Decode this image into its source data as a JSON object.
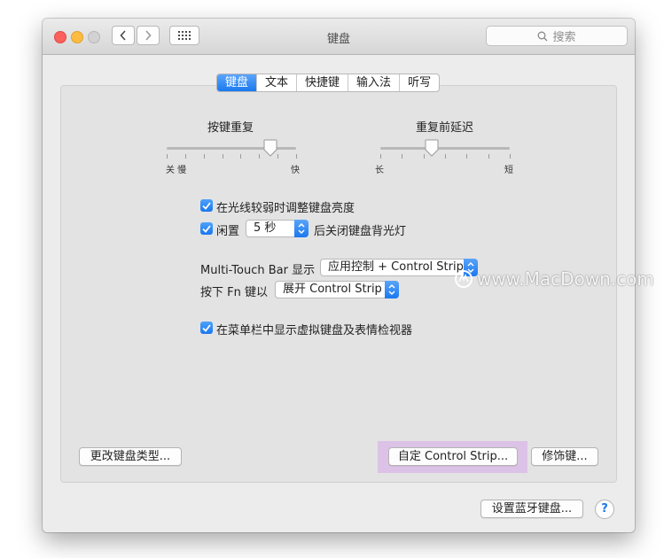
{
  "window": {
    "title": "键盘",
    "search_placeholder": "搜索"
  },
  "tabs": [
    {
      "label": "键盘",
      "active": true
    },
    {
      "label": "文本",
      "active": false
    },
    {
      "label": "快捷键",
      "active": false
    },
    {
      "label": "输入法",
      "active": false
    },
    {
      "label": "听写",
      "active": false
    }
  ],
  "key_repeat": {
    "title": "按键重复",
    "left_label": "关 慢",
    "right_label": "快",
    "value_fraction": 0.8
  },
  "delay_until_repeat": {
    "title": "重复前延迟",
    "left_label": "长",
    "right_label": "短",
    "value_fraction": 0.4
  },
  "options": {
    "adjust_brightness": {
      "label": "在光线较弱时调整键盘亮度",
      "checked": true
    },
    "idle": {
      "label": "闲置",
      "select_value": "5 秒",
      "suffix": "后关闭键盘背光灯",
      "checked": true
    },
    "touch_bar": {
      "label": "Multi-Touch Bar 显示",
      "select_value": "应用控制 + Control Strip"
    },
    "fn_key": {
      "label": "按下 Fn 键以",
      "select_value": "展开 Control Strip"
    },
    "show_viewer": {
      "label": "在菜单栏中显示虚拟键盘及表情检视器",
      "checked": true
    }
  },
  "buttons": {
    "change_type": "更改键盘类型...",
    "customize_strip": "自定 Control Strip...",
    "modifier_keys": "修饰键...",
    "bluetooth_keyboard": "设置蓝牙键盘...",
    "help": "?"
  },
  "watermark": "www.MacDown.com",
  "colors": {
    "accent": "#1b79ef",
    "highlight": "#dcc2e6"
  }
}
